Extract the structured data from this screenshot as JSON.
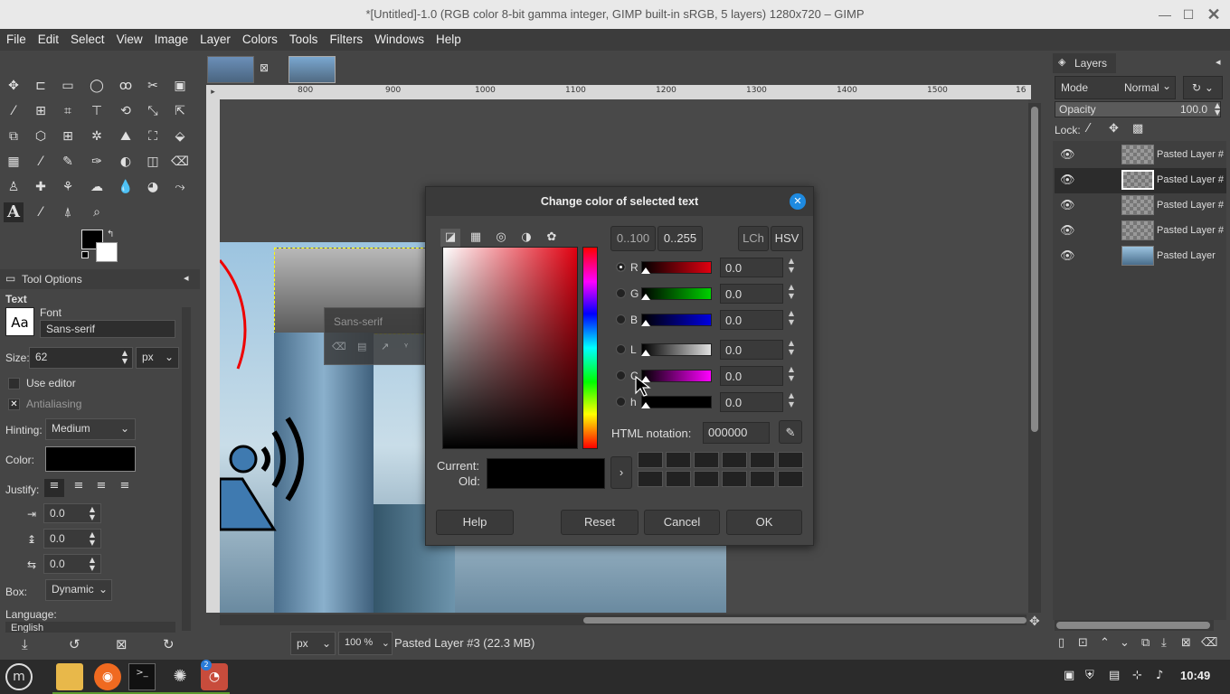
{
  "window": {
    "title": "*[Untitled]-1.0 (RGB color 8-bit gamma integer, GIMP built-in sRGB, 5 layers) 1280x720 – GIMP"
  },
  "menu": [
    "File",
    "Edit",
    "Select",
    "View",
    "Image",
    "Layer",
    "Colors",
    "Tools",
    "Filters",
    "Windows",
    "Help"
  ],
  "ruler": {
    "ticks": [
      "800",
      "900",
      "1000",
      "1100",
      "1200",
      "1300",
      "1400",
      "1500",
      "16"
    ]
  },
  "tool_options": {
    "title": "Tool Options",
    "section": "Text",
    "font_label": "Font",
    "font_preview": "Aa",
    "font_value": "Sans-serif",
    "size_label": "Size:",
    "size_value": "62",
    "size_unit": "px",
    "use_editor": "Use editor",
    "antialiasing": "Antialiasing",
    "hinting_label": "Hinting:",
    "hinting_value": "Medium",
    "color_label": "Color:",
    "justify_label": "Justify:",
    "indent_value": "0.0",
    "line_spacing_value": "0.0",
    "letter_spacing_value": "0.0",
    "box_label": "Box:",
    "box_value": "Dynamic",
    "language_label": "Language:",
    "language_value": "English"
  },
  "text_toolbar": {
    "font": "Sans-serif"
  },
  "dialog": {
    "title": "Change color of selected text",
    "range_buttons": [
      "0..100",
      "0..255"
    ],
    "model_buttons": [
      "LCh",
      "HSV"
    ],
    "channels": [
      {
        "name": "R",
        "value": "0.0",
        "color": "#e00010",
        "level": 0
      },
      {
        "name": "G",
        "value": "0.0",
        "color": "#00d000",
        "level": 0
      },
      {
        "name": "B",
        "value": "0.0",
        "color": "#0000e0",
        "level": 0
      },
      {
        "name": "L",
        "value": "0.0",
        "color": "#e0e0e0",
        "level": 0
      },
      {
        "name": "C",
        "value": "0.0",
        "color": "#ff00ff",
        "level": 0
      },
      {
        "name": "h",
        "value": "0.0",
        "color": "#000000",
        "level": 0
      }
    ],
    "html_label": "HTML notation:",
    "html_value": "000000",
    "current_label": "Current:",
    "old_label": "Old:",
    "buttons": {
      "help": "Help",
      "reset": "Reset",
      "cancel": "Cancel",
      "ok": "OK"
    }
  },
  "layers": {
    "tab": "Layers",
    "mode_label": "Mode",
    "mode_value": "Normal",
    "opacity_label": "Opacity",
    "opacity_value": "100.0",
    "lock_label": "Lock:",
    "items": [
      {
        "name": "Pasted Layer #"
      },
      {
        "name": "Pasted Layer #"
      },
      {
        "name": "Pasted Layer #"
      },
      {
        "name": "Pasted Layer #"
      },
      {
        "name": "Pasted Layer"
      }
    ]
  },
  "status": {
    "unit": "px",
    "zoom": "100 %",
    "message": "Pasted Layer #3 (22.3 MB)"
  },
  "taskbar": {
    "clock": "10:49",
    "badge": "2"
  },
  "colors": {
    "accent": "#1e8ae0",
    "text_color": "#000000"
  }
}
